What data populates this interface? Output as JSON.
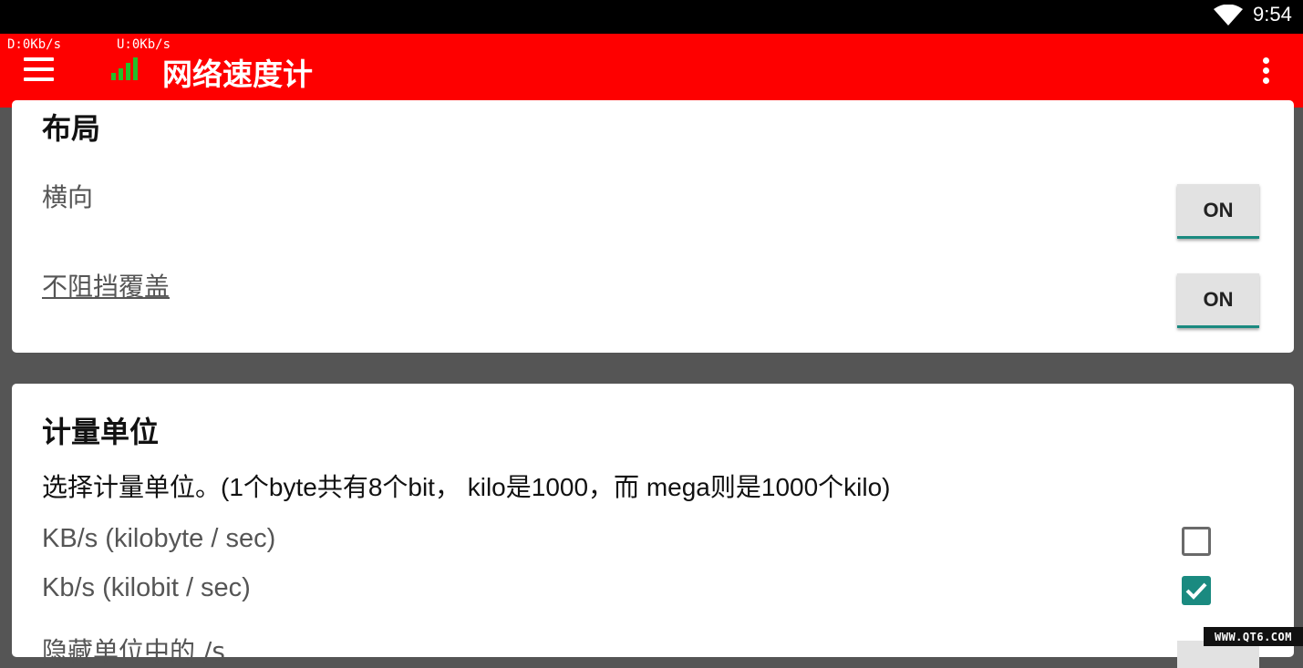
{
  "status_bar": {
    "time": "9:54",
    "wifi_icon": "wifi-icon"
  },
  "app_bar": {
    "download_speed": "D:0Kb/s",
    "upload_speed": "U:0Kb/s",
    "title": "网络速度计",
    "menu_icon": "hamburger-menu-icon",
    "app_icon": "signal-bars-icon",
    "overflow_icon": "more-vert-icon",
    "color": "#fe0000"
  },
  "layout_section": {
    "title": "布局",
    "items": [
      {
        "label": "横向",
        "toggle": "ON"
      },
      {
        "label": "不阻挡覆盖",
        "toggle": "ON"
      }
    ]
  },
  "units_section": {
    "title": "计量单位",
    "description": "选择计量单位。(1个byte共有8个bit， kilo是1000，而 mega则是1000个kilo)",
    "options": [
      {
        "label": "KB/s (kilobyte / sec)",
        "checked": false
      },
      {
        "label": "Kb/s (kilobit / sec)",
        "checked": true
      }
    ],
    "partial_item": "隐藏单位中的 /s"
  },
  "watermark": "WWW.QT6.COM",
  "colors": {
    "accent": "#1a8a80",
    "background": "#555555"
  }
}
